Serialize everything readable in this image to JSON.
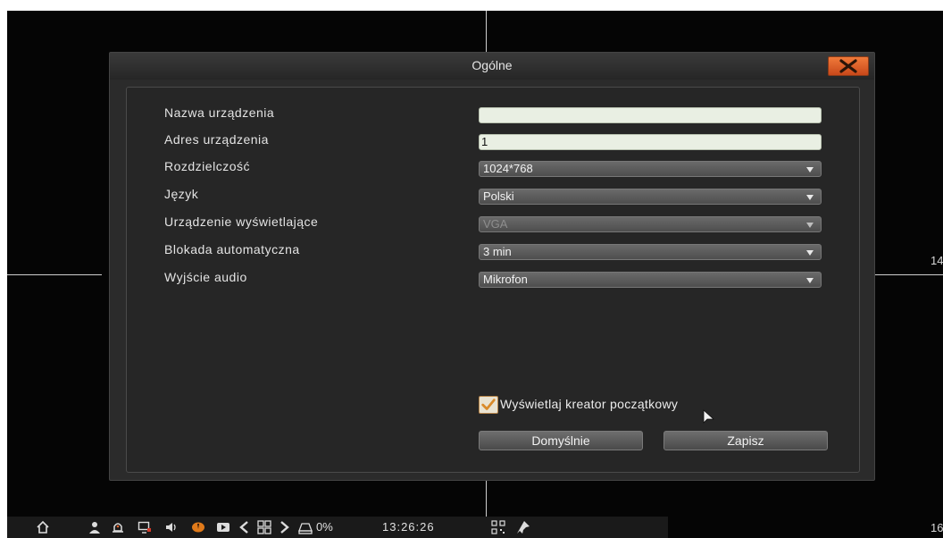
{
  "dialog": {
    "title": "Ogólne",
    "fields": [
      {
        "label": "Nazwa urządzenia",
        "type": "text",
        "value": ""
      },
      {
        "label": "Adres urządzenia",
        "type": "text",
        "value": "1"
      },
      {
        "label": "Rozdzielczość",
        "type": "select",
        "value": "1024*768"
      },
      {
        "label": "Język",
        "type": "select",
        "value": "Polski"
      },
      {
        "label": "Urządzenie wyświetlające",
        "type": "select",
        "value": "VGA",
        "disabled": true
      },
      {
        "label": "Blokada automatyczna",
        "type": "select",
        "value": "3 min"
      },
      {
        "label": "Wyjście audio",
        "type": "select",
        "value": "Mikrofon"
      }
    ],
    "wizard_checkbox": {
      "label": "Wyświetlaj kreator początkowy",
      "checked": true
    },
    "buttons": {
      "default": "Domyślnie",
      "save": "Zapisz"
    }
  },
  "background": {
    "edge_label_top": "14",
    "edge_label_bottom": "16"
  },
  "taskbar": {
    "icons": [
      "home-icon",
      "user-icon",
      "alarm-icon",
      "monitor-icon",
      "volume-icon",
      "record-icon",
      "play-icon",
      "prev-icon",
      "grid-icon",
      "next-icon",
      "hdd-icon"
    ],
    "hdd_usage": "0%",
    "time": "13:26:26",
    "extra_icons": [
      "qr-icon",
      "pin-icon"
    ]
  },
  "colors": {
    "accent_close": "#e0602a",
    "checkbox_border": "#b8864a"
  }
}
